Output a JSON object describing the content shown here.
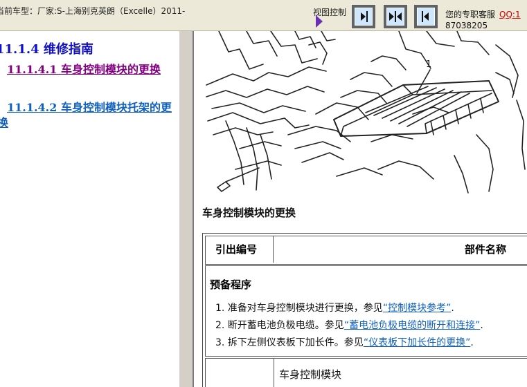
{
  "header": {
    "vehicle": "当前车型：厂家:S-上海别克英朗（Excelle）2011-",
    "view_control_label": "视图控制",
    "support_label": "您的专职客服",
    "qq_label": "QQ:1",
    "phone_fragment": "87038205"
  },
  "toc": {
    "title": "11.1.4 维修指南",
    "items": [
      {
        "label": "11.1.4.1 车身控制模块的更换"
      },
      {
        "label": "11.1.4.2 车身控制模块托架的更换"
      }
    ]
  },
  "content": {
    "figure_callout": "1",
    "section_title": "车身控制模块的更换",
    "table": {
      "col_ref": "引出编号",
      "col_name": "部件名称",
      "prep_title": "预备程序",
      "steps": [
        {
          "text": "1. 准备对车身控制模块进行更换，参见",
          "link": "“控制模块参考”",
          "tail": "."
        },
        {
          "text": "2. 断开蓄电池负极电缆。参见",
          "link": "“蓄电池负极电缆的断开和连接”",
          "tail": "."
        },
        {
          "text": "3. 拆下左侧仪表板下加长件。参见",
          "link": "“仪表板下加长件的更换”",
          "tail": "."
        }
      ],
      "row3_name": "车身控制模块"
    }
  }
}
